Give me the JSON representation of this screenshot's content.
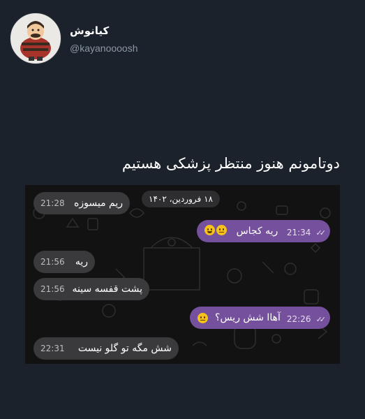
{
  "profile": {
    "display_name": "کیانوش",
    "handle": "@kayanoooosh"
  },
  "tweet": {
    "text": "دوتامونم هنوز منتظر پزشکی هستیم"
  },
  "chat": {
    "date_label": "۱۸ فروردین، ۱۴۰۲",
    "messages": [
      {
        "side": "in",
        "text": "ریم میسوزه",
        "time": "21:28"
      },
      {
        "side": "out",
        "text": "ریه کجاس",
        "time": "21:34",
        "emoji": [
          "neutral-face-icon",
          "laughing-face-icon"
        ]
      },
      {
        "side": "in",
        "text": "ریه",
        "time": "21:56"
      },
      {
        "side": "in",
        "text": "پشت قفسه سینه",
        "time": "21:56"
      },
      {
        "side": "out",
        "text": "آهاا شش ریس؟",
        "time": "22:26",
        "emoji": [
          "neutral-face-icon"
        ]
      },
      {
        "side": "in",
        "text": "شش مگه تو گلو نیست",
        "time": "22:31"
      }
    ]
  },
  "colors": {
    "page_bg": "#1b222b",
    "chat_bg": "#121212",
    "incoming_bubble": "#3a3a3c",
    "outgoing_bubble": "#75509c",
    "handle_text": "#8b98a5"
  }
}
